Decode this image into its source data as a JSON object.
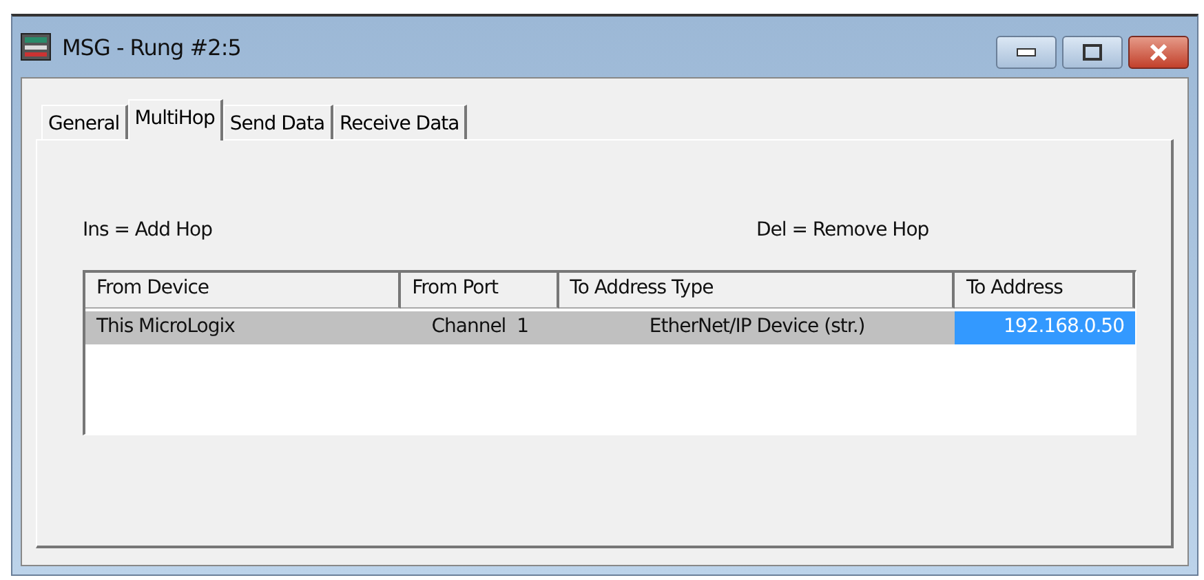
{
  "window": {
    "title": "MSG - Rung #2:5"
  },
  "tabs": [
    {
      "label": "General",
      "selected": false
    },
    {
      "label": "MultiHop",
      "selected": true
    },
    {
      "label": "Send Data",
      "selected": false
    },
    {
      "label": "Receive Data",
      "selected": false
    }
  ],
  "hints": {
    "add": "Ins = Add Hop",
    "remove": "Del = Remove Hop"
  },
  "table": {
    "columns": [
      "From Device",
      "From Port",
      "To Address Type",
      "To Address"
    ],
    "rows": [
      {
        "selected": true,
        "cells": [
          {
            "text": "This MicroLogix",
            "selected": false
          },
          {
            "text": "Channel  1",
            "selected": false
          },
          {
            "text": "EtherNet/IP Device (str.)",
            "selected": false
          },
          {
            "text": "192.168.0.50",
            "selected": true
          }
        ]
      }
    ]
  }
}
